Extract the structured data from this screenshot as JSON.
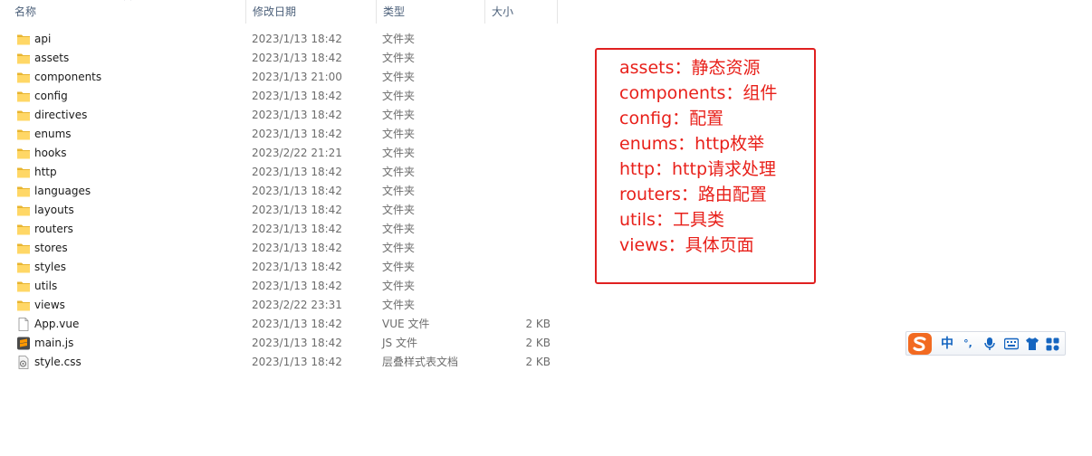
{
  "columns": {
    "name": "名称",
    "date": "修改日期",
    "type": "类型",
    "size": "大小"
  },
  "files": [
    {
      "name": "api",
      "date": "2023/1/13 18:42",
      "type": "文件夹",
      "size": "",
      "icon": "folder-icon"
    },
    {
      "name": "assets",
      "date": "2023/1/13 18:42",
      "type": "文件夹",
      "size": "",
      "icon": "folder-icon"
    },
    {
      "name": "components",
      "date": "2023/1/13 21:00",
      "type": "文件夹",
      "size": "",
      "icon": "folder-icon"
    },
    {
      "name": "config",
      "date": "2023/1/13 18:42",
      "type": "文件夹",
      "size": "",
      "icon": "folder-icon"
    },
    {
      "name": "directives",
      "date": "2023/1/13 18:42",
      "type": "文件夹",
      "size": "",
      "icon": "folder-icon"
    },
    {
      "name": "enums",
      "date": "2023/1/13 18:42",
      "type": "文件夹",
      "size": "",
      "icon": "folder-icon"
    },
    {
      "name": "hooks",
      "date": "2023/2/22 21:21",
      "type": "文件夹",
      "size": "",
      "icon": "folder-icon"
    },
    {
      "name": "http",
      "date": "2023/1/13 18:42",
      "type": "文件夹",
      "size": "",
      "icon": "folder-icon"
    },
    {
      "name": "languages",
      "date": "2023/1/13 18:42",
      "type": "文件夹",
      "size": "",
      "icon": "folder-icon"
    },
    {
      "name": "layouts",
      "date": "2023/1/13 18:42",
      "type": "文件夹",
      "size": "",
      "icon": "folder-icon"
    },
    {
      "name": "routers",
      "date": "2023/1/13 18:42",
      "type": "文件夹",
      "size": "",
      "icon": "folder-icon"
    },
    {
      "name": "stores",
      "date": "2023/1/13 18:42",
      "type": "文件夹",
      "size": "",
      "icon": "folder-icon"
    },
    {
      "name": "styles",
      "date": "2023/1/13 18:42",
      "type": "文件夹",
      "size": "",
      "icon": "folder-icon"
    },
    {
      "name": "utils",
      "date": "2023/1/13 18:42",
      "type": "文件夹",
      "size": "",
      "icon": "folder-icon"
    },
    {
      "name": "views",
      "date": "2023/2/22 23:31",
      "type": "文件夹",
      "size": "",
      "icon": "folder-icon"
    },
    {
      "name": "App.vue",
      "date": "2023/1/13 18:42",
      "type": "VUE 文件",
      "size": "2 KB",
      "icon": "file-icon"
    },
    {
      "name": "main.js",
      "date": "2023/1/13 18:42",
      "type": "JS 文件",
      "size": "2 KB",
      "icon": "sublime-text-icon"
    },
    {
      "name": "style.css",
      "date": "2023/1/13 18:42",
      "type": "层叠样式表文档",
      "size": "2 KB",
      "icon": "css-file-icon"
    }
  ],
  "annotation": {
    "lines": [
      "assets：静态资源",
      "components：组件",
      "config：配置",
      "enums：http枚举",
      "http：http请求处理",
      "routers：路由配置",
      "utils：工具类",
      "views：具体页面"
    ],
    "color": "#e8201a"
  },
  "ime_toolbar": {
    "mode": "中",
    "punct": "°,",
    "icons": [
      "sogou-logo-icon",
      "microphone-icon",
      "keyboard-icon",
      "skin-shirt-icon",
      "toolbox-icon"
    ],
    "accent": "#1565c0"
  }
}
